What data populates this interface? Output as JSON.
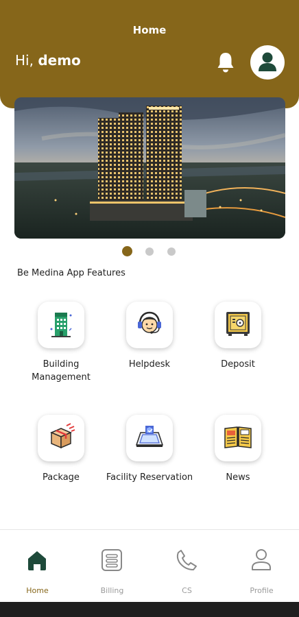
{
  "header": {
    "title": "Home",
    "greeting_prefix": "Hi, ",
    "user_name": "demo",
    "bg_color": "#86661a"
  },
  "carousel": {
    "slide_count": 3,
    "active_index": 0
  },
  "features": {
    "section_title": "Be Medina App Features",
    "items": [
      {
        "label": "Building Management",
        "icon": "building-icon"
      },
      {
        "label": "Helpdesk",
        "icon": "helpdesk-headset-icon"
      },
      {
        "label": "Deposit",
        "icon": "safe-icon"
      },
      {
        "label": "Package",
        "icon": "package-box-icon"
      },
      {
        "label": "Facility Reservation",
        "icon": "facility-reservation-icon"
      },
      {
        "label": "News",
        "icon": "newspaper-icon"
      }
    ]
  },
  "bottom_nav": {
    "items": [
      {
        "label": "Home",
        "icon": "home-icon",
        "active": true
      },
      {
        "label": "Billing",
        "icon": "billing-icon",
        "active": false
      },
      {
        "label": "CS",
        "icon": "phone-icon",
        "active": false
      },
      {
        "label": "Profile",
        "icon": "profile-icon",
        "active": false
      }
    ],
    "active_color": "#86661a",
    "inactive_color": "#9a9a9a"
  }
}
